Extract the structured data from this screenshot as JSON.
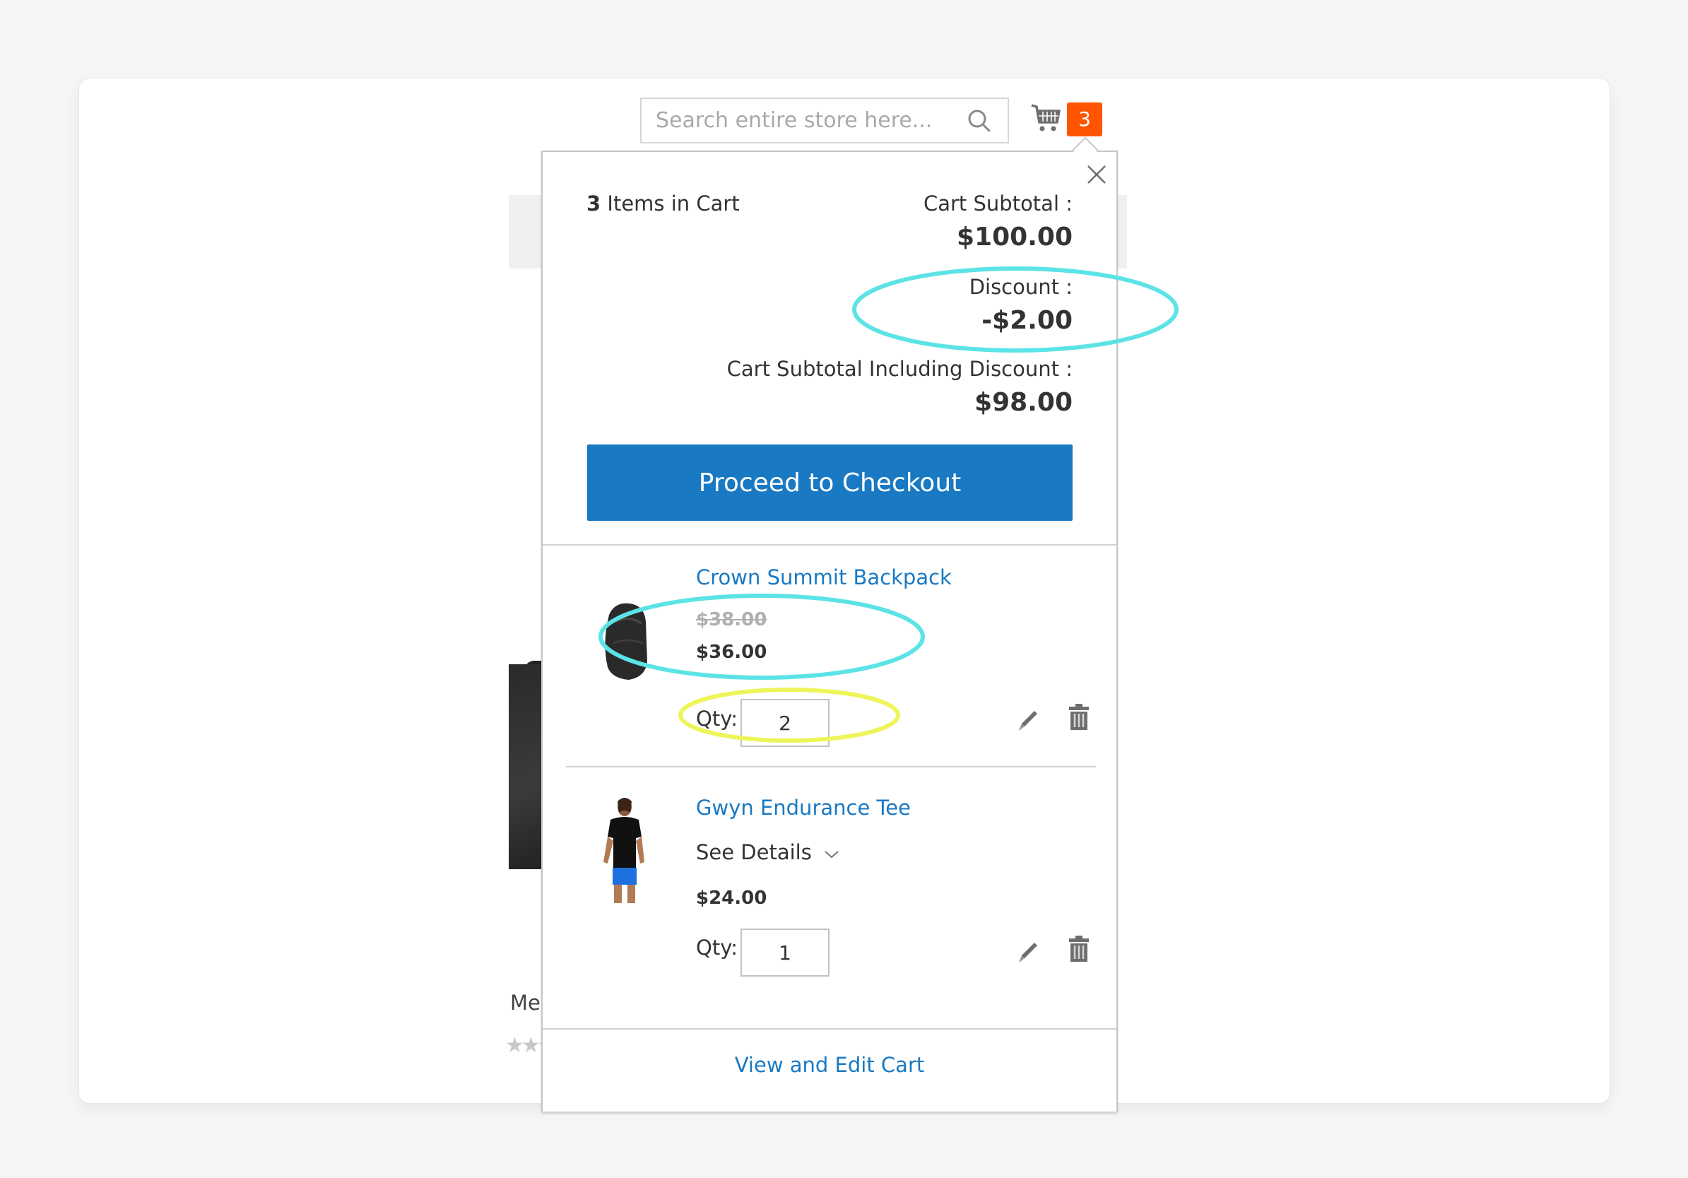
{
  "header": {
    "search": {
      "placeholder": "Search entire store here...",
      "value": ""
    },
    "cart_count": "3"
  },
  "background_page": {
    "product_name_partial": "Me",
    "rating_stars": "★★★★★"
  },
  "minicart": {
    "items_count": "3",
    "items_label": " Items in Cart",
    "subtotal_label": "Cart Subtotal :",
    "subtotal_value": "$100.00",
    "discount_label": "Discount :",
    "discount_value": "-$2.00",
    "subtotal_incl_label": "Cart Subtotal Including Discount :",
    "subtotal_incl_value": "$98.00",
    "checkout_label": "Proceed to Checkout",
    "view_edit_label": "View and Edit Cart",
    "items": [
      {
        "name": "Crown Summit Backpack",
        "old_price": "$38.00",
        "price": "$36.00",
        "qty_label": "Qty:",
        "qty": "2"
      },
      {
        "name": "Gwyn Endurance Tee",
        "see_details": "See Details",
        "price": "$24.00",
        "qty_label": "Qty:",
        "qty": "1"
      }
    ]
  },
  "annotations": {
    "highlight_teal": "#5ce3e6",
    "highlight_yellow": "#eef55a"
  },
  "colors": {
    "brand_blue": "#1979c3",
    "badge_orange": "#ff5501"
  }
}
